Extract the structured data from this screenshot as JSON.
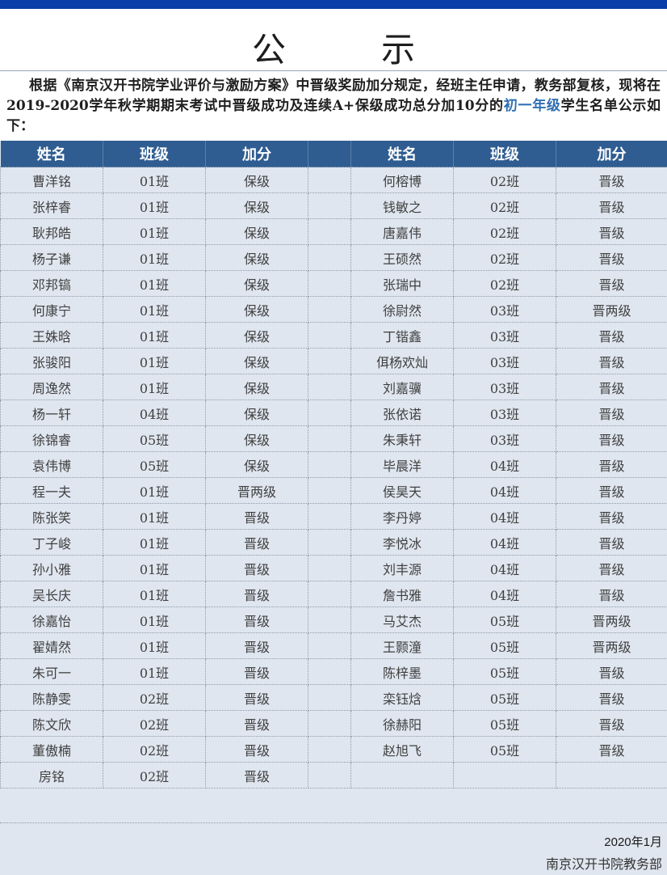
{
  "title": "公　示",
  "intro": {
    "before": "根据《南京汉开书院学业评价与激励方案》中晋级奖励加分规定，经班主任申请，教务部复核，现将在2019-2020学年秋学期期末考试中晋级成功及连续A+保级成功总分加10分的",
    "highlight": "初一年级",
    "after": "学生名单公示如下："
  },
  "headers": [
    "姓名",
    "班级",
    "加分",
    "姓名",
    "班级",
    "加分"
  ],
  "left": [
    [
      "曹洋铭",
      "01班",
      "保级"
    ],
    [
      "张梓睿",
      "01班",
      "保级"
    ],
    [
      "耿邦皓",
      "01班",
      "保级"
    ],
    [
      "杨子谦",
      "01班",
      "保级"
    ],
    [
      "邓邦镐",
      "01班",
      "保级"
    ],
    [
      "何康宁",
      "01班",
      "保级"
    ],
    [
      "王姝晗",
      "01班",
      "保级"
    ],
    [
      "张骏阳",
      "01班",
      "保级"
    ],
    [
      "周逸然",
      "01班",
      "保级"
    ],
    [
      "杨一轩",
      "04班",
      "保级"
    ],
    [
      "徐锦睿",
      "05班",
      "保级"
    ],
    [
      "袁伟博",
      "05班",
      "保级"
    ],
    [
      "程一夫",
      "01班",
      "晋两级"
    ],
    [
      "陈张笑",
      "01班",
      "晋级"
    ],
    [
      "丁子峻",
      "01班",
      "晋级"
    ],
    [
      "孙小雅",
      "01班",
      "晋级"
    ],
    [
      "吴长庆",
      "01班",
      "晋级"
    ],
    [
      "徐嘉怡",
      "01班",
      "晋级"
    ],
    [
      "翟婧然",
      "01班",
      "晋级"
    ],
    [
      "朱可一",
      "01班",
      "晋级"
    ],
    [
      "陈静雯",
      "02班",
      "晋级"
    ],
    [
      "陈文欣",
      "02班",
      "晋级"
    ],
    [
      "董傲楠",
      "02班",
      "晋级"
    ],
    [
      "房铭",
      "02班",
      "晋级"
    ]
  ],
  "right": [
    [
      "何榕博",
      "02班",
      "晋级"
    ],
    [
      "钱敏之",
      "02班",
      "晋级"
    ],
    [
      "唐嘉伟",
      "02班",
      "晋级"
    ],
    [
      "王硕然",
      "02班",
      "晋级"
    ],
    [
      "张瑞中",
      "02班",
      "晋级"
    ],
    [
      "徐尉然",
      "03班",
      "晋两级"
    ],
    [
      "丁锴鑫",
      "03班",
      "晋级"
    ],
    [
      "佴杨欢灿",
      "03班",
      "晋级"
    ],
    [
      "刘嘉骥",
      "03班",
      "晋级"
    ],
    [
      "张依诺",
      "03班",
      "晋级"
    ],
    [
      "朱秉轩",
      "03班",
      "晋级"
    ],
    [
      "毕晨洋",
      "04班",
      "晋级"
    ],
    [
      "侯昊天",
      "04班",
      "晋级"
    ],
    [
      "李丹婷",
      "04班",
      "晋级"
    ],
    [
      "李悦冰",
      "04班",
      "晋级"
    ],
    [
      "刘丰源",
      "04班",
      "晋级"
    ],
    [
      "詹书雅",
      "04班",
      "晋级"
    ],
    [
      "马艾杰",
      "05班",
      "晋两级"
    ],
    [
      "王颢潼",
      "05班",
      "晋两级"
    ],
    [
      "陈梓墨",
      "05班",
      "晋级"
    ],
    [
      "栾钰焓",
      "05班",
      "晋级"
    ],
    [
      "徐赫阳",
      "05班",
      "晋级"
    ],
    [
      "赵旭飞",
      "05班",
      "晋级"
    ],
    [
      "",
      "",
      ""
    ]
  ],
  "footer": {
    "date": "2020年1月",
    "department": "南京汉开书院教务部"
  }
}
